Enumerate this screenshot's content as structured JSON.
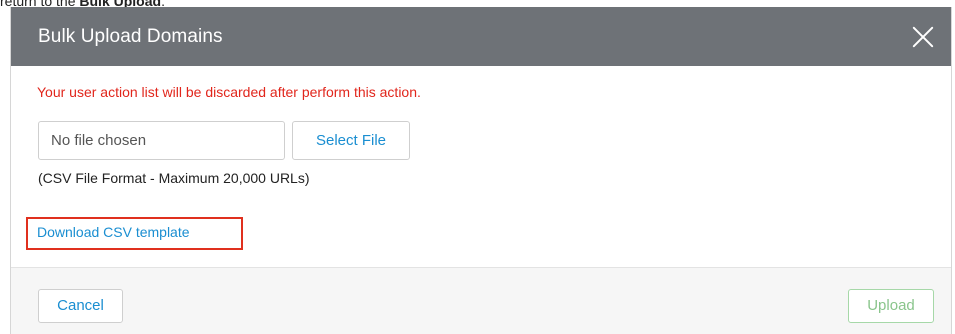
{
  "document": {
    "text_prefix": "return to the ",
    "text_bold": "Bulk Upload",
    "text_suffix": "."
  },
  "modal": {
    "title": "Bulk Upload Domains",
    "close_icon": "close-icon"
  },
  "body": {
    "warning": "Your user action list will be discarded after perform this action.",
    "file_input_value": "No file chosen",
    "select_file_label": "Select File",
    "hint": "(CSV File Format - Maximum 20,000 URLs)",
    "download_link": "Download CSV template"
  },
  "footer": {
    "cancel_label": "Cancel",
    "upload_label": "Upload"
  },
  "colors": {
    "header_bg": "#6e7277",
    "warning": "#e1261c",
    "link": "#1a8ed1",
    "highlight_box": "#e0301e",
    "upload_disabled": "#8ac58c"
  }
}
